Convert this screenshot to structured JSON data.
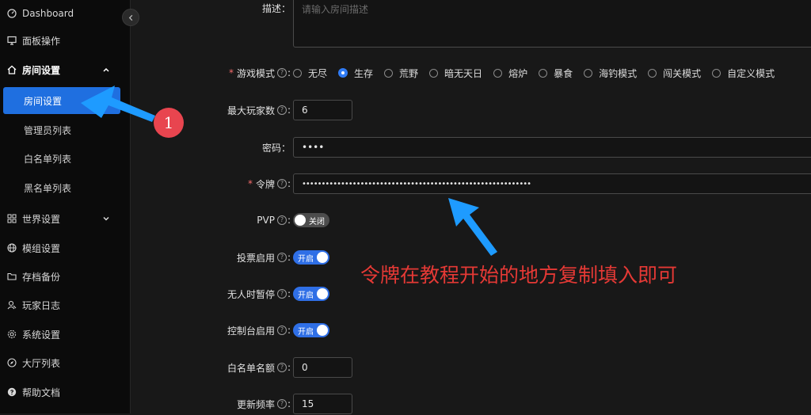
{
  "sidebar": {
    "items": [
      {
        "label": "Dashboard",
        "icon": "dashboard-icon"
      },
      {
        "label": "面板操作",
        "icon": "monitor-icon"
      },
      {
        "label": "房间设置",
        "icon": "home-icon",
        "expanded": true
      },
      {
        "label": "房间设置",
        "sub": true,
        "active": true
      },
      {
        "label": "管理员列表",
        "sub": true
      },
      {
        "label": "白名单列表",
        "sub": true
      },
      {
        "label": "黑名单列表",
        "sub": true
      },
      {
        "label": "世界设置",
        "icon": "grid-icon"
      },
      {
        "label": "模组设置",
        "icon": "globe-icon"
      },
      {
        "label": "存档备份",
        "icon": "folder-icon"
      },
      {
        "label": "玩家日志",
        "icon": "user-icon"
      },
      {
        "label": "系统设置",
        "icon": "gear-icon"
      },
      {
        "label": "大厅列表",
        "icon": "compass-icon"
      },
      {
        "label": "帮助文档",
        "icon": "help-icon"
      }
    ]
  },
  "form": {
    "description": {
      "label": "描述：",
      "placeholder": "请输入房间描述"
    },
    "game_mode": {
      "label": "游戏模式",
      "options": [
        "无尽",
        "生存",
        "荒野",
        "暗无天日",
        "熔炉",
        "暴食",
        "海钓模式",
        "闯关模式",
        "自定义模式"
      ],
      "selected": "生存"
    },
    "max_players": {
      "label": "最大玩家数",
      "value": "6"
    },
    "password": {
      "label": "密码：",
      "value": "••••"
    },
    "token": {
      "label": "令牌",
      "value": "•••••••••••••••••••••••••••••••••••••••••••••••••••••••••••"
    },
    "pvp": {
      "label": "PVP",
      "state": "关闭"
    },
    "vote": {
      "label": "投票启用",
      "state": "开启"
    },
    "pause_when_empty": {
      "label": "无人时暂停",
      "state": "开启"
    },
    "console": {
      "label": "控制台启用",
      "state": "开启"
    },
    "whitelist_slots": {
      "label": "白名单名额",
      "value": "0"
    },
    "update_freq": {
      "label": "更新频率",
      "value": "15"
    }
  },
  "annotations": {
    "badge_number": "1",
    "tip_text": "令牌在教程开始的地方复制填入即可",
    "color": "#e53935"
  },
  "colors": {
    "accent": "#1f6fe0",
    "switch_on": "#2f6fe6",
    "arrow": "#1e9bff"
  }
}
